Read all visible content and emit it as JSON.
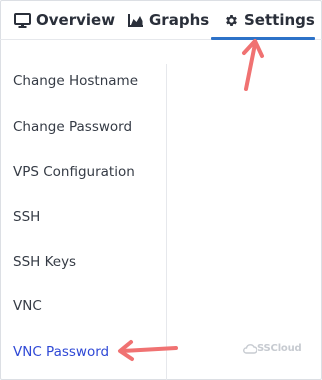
{
  "tabs": [
    {
      "label": "Overview",
      "icon": "monitor-icon"
    },
    {
      "label": "Graphs",
      "icon": "area-chart-icon"
    },
    {
      "label": "Settings",
      "icon": "gear-icon",
      "active": true
    }
  ],
  "menu": {
    "items": [
      {
        "label": "Change Hostname"
      },
      {
        "label": "Change Password"
      },
      {
        "label": "VPS Configuration"
      },
      {
        "label": "SSH"
      },
      {
        "label": "SSH Keys"
      },
      {
        "label": "VNC"
      },
      {
        "label": "VNC Password",
        "active": true
      }
    ]
  },
  "watermark": {
    "text": "SSCloud"
  },
  "colors": {
    "accent": "#2d72c8",
    "active_link": "#2f49d6",
    "annotation_arrow": "#f07272"
  }
}
